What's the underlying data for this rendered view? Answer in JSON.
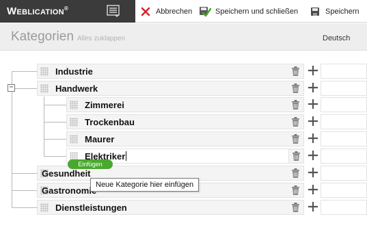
{
  "app": {
    "brand": "Weblication",
    "brand_mark": "®"
  },
  "toolbar": {
    "cancel_label": "Abbrechen",
    "save_close_label": "Speichern und schließen",
    "save_label": "Speichern"
  },
  "header": {
    "title": "Kategorien",
    "collapse_all": "Alles zuklappen",
    "language": "Deutsch"
  },
  "tree": {
    "toggle": "−",
    "items": [
      {
        "label": "Industrie"
      },
      {
        "label": "Handwerk"
      },
      {
        "label": "Zimmerei"
      },
      {
        "label": "Trockenbau"
      },
      {
        "label": "Maurer"
      },
      {
        "label": "Elektriker"
      },
      {
        "label": "Gesundheit"
      },
      {
        "label": "Gastronomie"
      },
      {
        "label": "Dienstleistungen"
      }
    ]
  },
  "insert": {
    "pill_label": "Einfügen",
    "tooltip": "Neue Kategorie hier einfügen"
  },
  "colors": {
    "brand_bg": "#3b3b3b",
    "cancel": "#d9232a",
    "accent_green": "#4aa82f"
  },
  "icons": [
    "menu-icon",
    "cancel-x-icon",
    "save-close-icon",
    "save-disk-icon",
    "drag-grip-icon",
    "trash-icon",
    "plus-icon"
  ]
}
